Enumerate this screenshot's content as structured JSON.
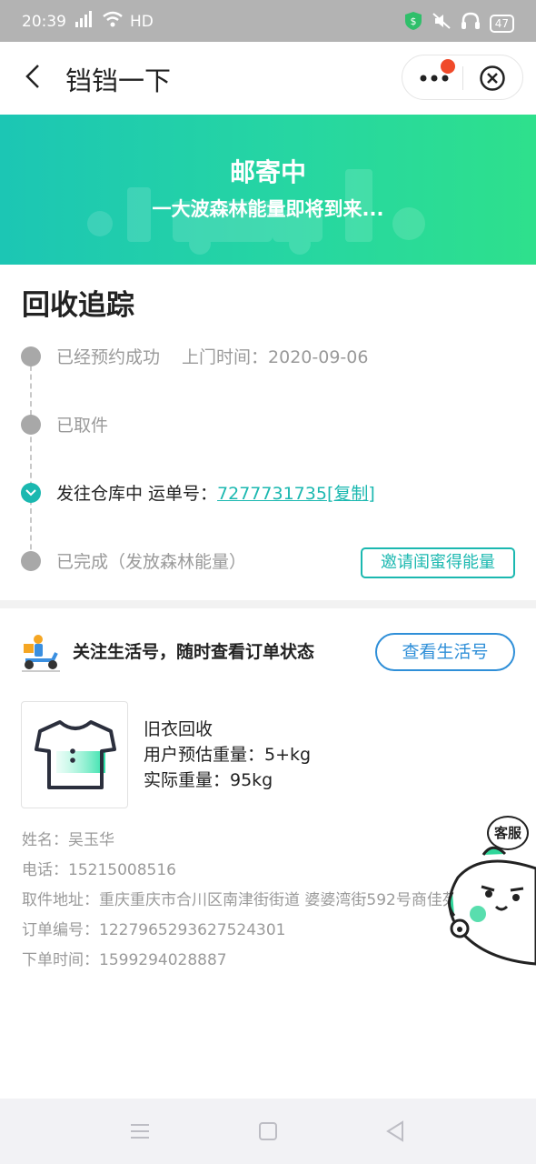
{
  "status_bar": {
    "time": "20:39",
    "network": "4G",
    "hd": "HD",
    "battery": "47"
  },
  "nav": {
    "title": "铛铛一下"
  },
  "banner": {
    "title": "邮寄中",
    "subtitle": "一大波森林能量即将到来..."
  },
  "tracking": {
    "title": "回收追踪",
    "steps": [
      {
        "label": "已经预约成功",
        "sub": "上门时间：2020-09-06"
      },
      {
        "label": "已取件"
      },
      {
        "label": "发往仓库中 运单号：",
        "tracking_number": "7277731735",
        "copy": "[复制]"
      },
      {
        "label": "已完成（发放森林能量）"
      }
    ],
    "invite_button": "邀请闺蜜得能量"
  },
  "follow": {
    "text": "关注生活号，随时查看订单状态",
    "button": "查看生活号"
  },
  "product": {
    "name": "旧衣回收",
    "estimate": "用户预估重量：5+kg",
    "actual": "实际重量：95kg"
  },
  "details": {
    "name": "姓名：吴玉华",
    "phone": "电话：15215008516",
    "address": "取件地址：重庆重庆市合川区南津街街道 婆婆湾街592号商佳苑",
    "order_no": "订单编号：1227965293627524301",
    "order_time": "下单时间：1599294028887"
  },
  "service": {
    "label": "客服"
  },
  "colors": {
    "accent": "#1bb8b0",
    "blue": "#2f8fd8",
    "banner_start": "#1cc6b4",
    "banner_end": "#2ee08c"
  }
}
